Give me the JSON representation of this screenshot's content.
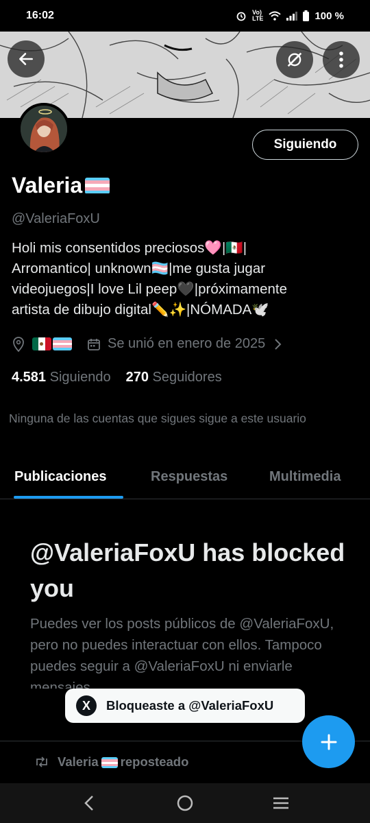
{
  "status_bar": {
    "time": "16:02",
    "battery": "100 %"
  },
  "profile": {
    "name": "Valeria",
    "handle": "@ValeriaFoxU",
    "follow_label": "Siguiendo",
    "bio_lines": [
      "Holi mis consentidos preciosos🩷|🇲🇽|",
      "Arromantico| unknown🏳️‍⚧️|me gusta jugar",
      "videojuegos|I love Lil peep🖤|próximamente",
      "artista de dibujo digital✏️✨|NÓMADA🕊️"
    ],
    "joined": "Se unió en enero de 2025",
    "following_count": "4.581",
    "following_label": "Siguiendo",
    "followers_count": "270",
    "followers_label": "Seguidores",
    "mutuals_text": "Ninguna de las cuentas que sigues sigue a este usuario"
  },
  "tabs": [
    {
      "label": "Publicaciones",
      "active": true
    },
    {
      "label": "Respuestas",
      "active": false
    },
    {
      "label": "Multimedia",
      "active": false
    }
  ],
  "blocked": {
    "title": "@ValeriaFoxU has blocked you",
    "description": "Puedes ver los posts públicos de @ValeriaFoxU, pero no puedes interactuar con ellos. Tampoco puedes seguir a @ValeriaFoxU ni enviarle mensajes."
  },
  "repost": {
    "name": "Valeria",
    "label": "reposteado"
  },
  "toast": {
    "icon": "X",
    "text": "Bloqueaste a @ValeriaFoxU"
  },
  "colors": {
    "accent": "#1d9bf0",
    "background": "#000000",
    "muted": "#71767b"
  },
  "icons": [
    "back-arrow-icon",
    "grok-icon",
    "more-vertical-icon",
    "location-icon",
    "calendar-icon",
    "chevron-right-icon",
    "repost-icon",
    "plus-icon",
    "nav-back-icon",
    "nav-home-icon",
    "nav-recents-icon"
  ]
}
